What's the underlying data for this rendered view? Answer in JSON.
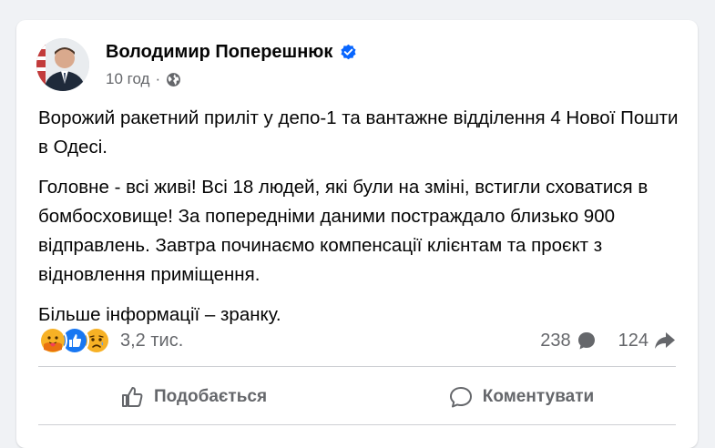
{
  "post": {
    "author": "Володимир Поперешнюк",
    "time": "10 год",
    "separator": "·",
    "paragraphs": [
      "Ворожий ракетний приліт у депо-1 та вантажне відділення 4 Нової Пошти в Одесі.",
      "Головне - всі живі! Всі 18 людей, які були на зміні, встигли сховатися в бомбосховище! За попередніми даними постраждало близько 900 відправлень. Завтра починаємо компенсації клієнтам та проєкт з відновлення приміщення.",
      "Більше інформації – зранку."
    ]
  },
  "reactions": {
    "icons": [
      "care-emoji",
      "like-emoji",
      "sad-emoji"
    ],
    "count": "3,2 тис."
  },
  "stats": {
    "comments": "238",
    "shares": "124"
  },
  "actions": {
    "like_label": "Подобається",
    "comment_label": "Коментувати"
  },
  "colors": {
    "verified": "#0866ff",
    "secondary_text": "#65676b",
    "like_blue": "#1877f2",
    "emoji_yellow": "#f7b125"
  }
}
